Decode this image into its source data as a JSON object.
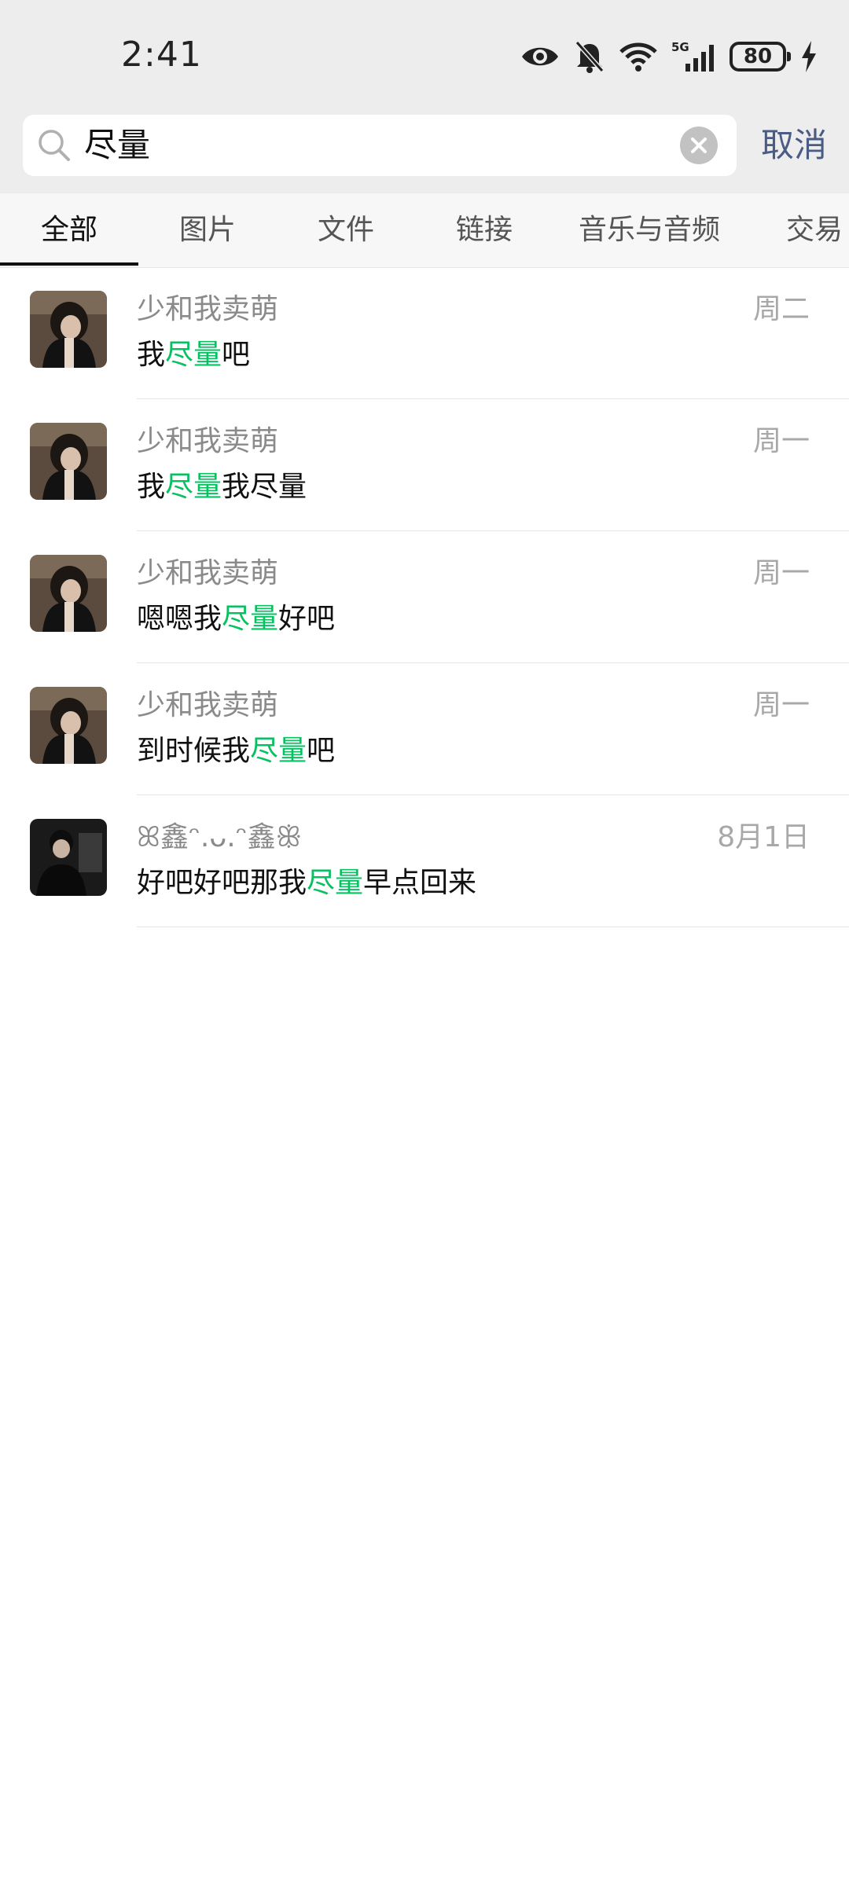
{
  "status_bar": {
    "time": "2:41",
    "battery": "80",
    "icons": [
      "eye-icon",
      "bell-off-icon",
      "wifi-icon",
      "signal-5g-icon",
      "battery-icon",
      "charging-icon"
    ]
  },
  "search": {
    "query": "尽量",
    "cancel_label": "取消"
  },
  "tabs": [
    {
      "label": "全部",
      "active": true
    },
    {
      "label": "图片"
    },
    {
      "label": "文件"
    },
    {
      "label": "链接"
    },
    {
      "label": "音乐与音频"
    },
    {
      "label": "交易"
    }
  ],
  "results": [
    {
      "name": "少和我卖萌",
      "date": "周二",
      "before": "我",
      "match": "尽量",
      "after": "吧"
    },
    {
      "name": "少和我卖萌",
      "date": "周一",
      "before": "我",
      "match": "尽量",
      "after": "我尽量"
    },
    {
      "name": "少和我卖萌",
      "date": "周一",
      "before": "嗯嗯我",
      "match": "尽量",
      "after": "好吧"
    },
    {
      "name": "少和我卖萌",
      "date": "周一",
      "before": "到时候我",
      "match": "尽量",
      "after": "吧"
    },
    {
      "name": "ꕤ鑫ᵔ.ᴗ.ᵔ鑫ꕥ",
      "date": "8月1日",
      "before": "好吧好吧那我",
      "match": "尽量",
      "after": "早点回来"
    }
  ],
  "colors": {
    "highlight": "#07c160",
    "cancel": "#4a5b86",
    "header_bg": "#ededed"
  }
}
